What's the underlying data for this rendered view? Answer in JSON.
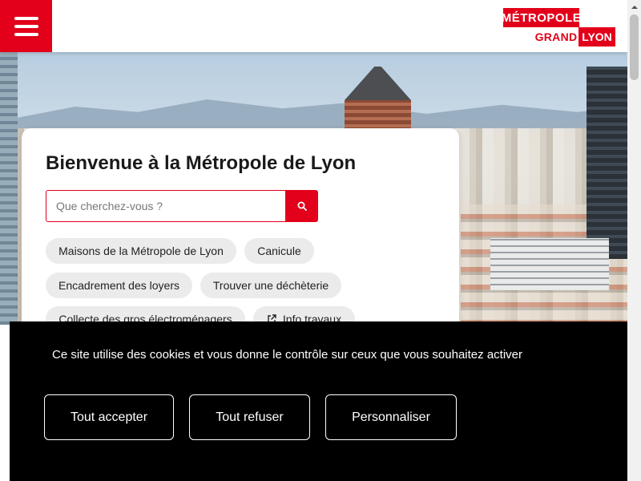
{
  "header": {
    "logo": {
      "top": "MÉTROPOLE",
      "grand": "GRAND",
      "lyon": "LYON"
    }
  },
  "main": {
    "title": "Bienvenue à la Métropole de Lyon",
    "search": {
      "placeholder": "Que cherchez-vous ?",
      "value": ""
    },
    "quick_links": [
      "Maisons de la Métropole de Lyon",
      "Canicule",
      "Encadrement des loyers",
      "Trouver une déchèterie",
      "Collecte des gros électroménagers",
      "Info travaux"
    ]
  },
  "cookie_banner": {
    "message": "Ce site utilise des cookies et vous donne le contrôle sur ceux que vous souhaitez activer",
    "accept_label": "Tout accepter",
    "refuse_label": "Tout refuser",
    "customize_label": "Personnaliser"
  },
  "colors": {
    "brand_red": "#e2001a",
    "banner_bg": "#000000"
  },
  "icons": {
    "menu": "hamburger-menu-icon",
    "search": "search-icon",
    "external": "external-link-icon",
    "scroll_up": "chevron-up-icon"
  }
}
